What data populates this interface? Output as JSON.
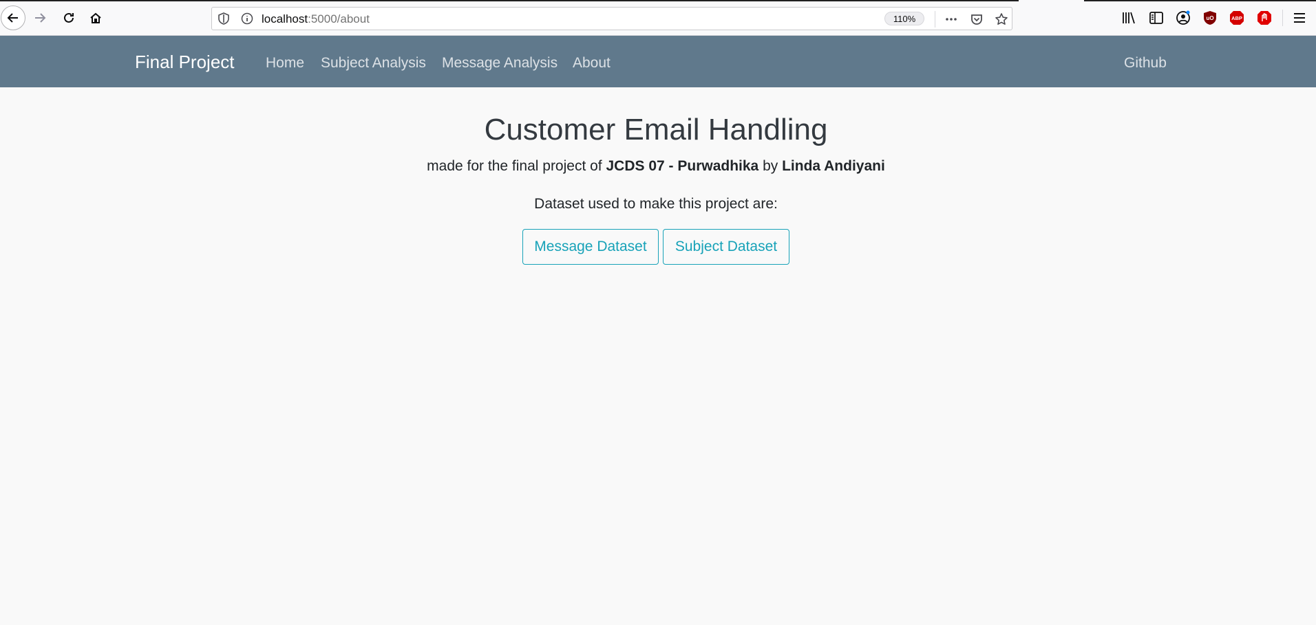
{
  "browser": {
    "url_host": "localhost",
    "url_rest": ":5000/about",
    "zoom": "110%",
    "abp_label": "ABP"
  },
  "navbar": {
    "brand": "Final Project",
    "links": [
      {
        "label": "Home"
      },
      {
        "label": "Subject Analysis"
      },
      {
        "label": "Message Analysis"
      },
      {
        "label": "About"
      }
    ],
    "github": "Github",
    "background": "#60798c"
  },
  "main": {
    "title": "Customer Email Handling",
    "byline": {
      "prefix": "made for the final project of ",
      "program": "JCDS 07 - Purwadhika",
      "middle": " by ",
      "author": "Linda Andiyani"
    },
    "dataset_intro": "Dataset used to make this project are:",
    "buttons": [
      {
        "label": "Message Dataset"
      },
      {
        "label": "Subject Dataset"
      }
    ],
    "accent": "#17a2b8"
  },
  "icons": [
    "back-arrow-icon",
    "forward-arrow-icon",
    "reload-icon",
    "home-icon",
    "shield-icon",
    "info-icon",
    "more-icon",
    "pocket-icon",
    "star-icon",
    "library-icon",
    "sidebar-icon",
    "account-icon",
    "ublock-icon",
    "abp-icon",
    "stop-icon",
    "hamburger-menu-icon"
  ]
}
